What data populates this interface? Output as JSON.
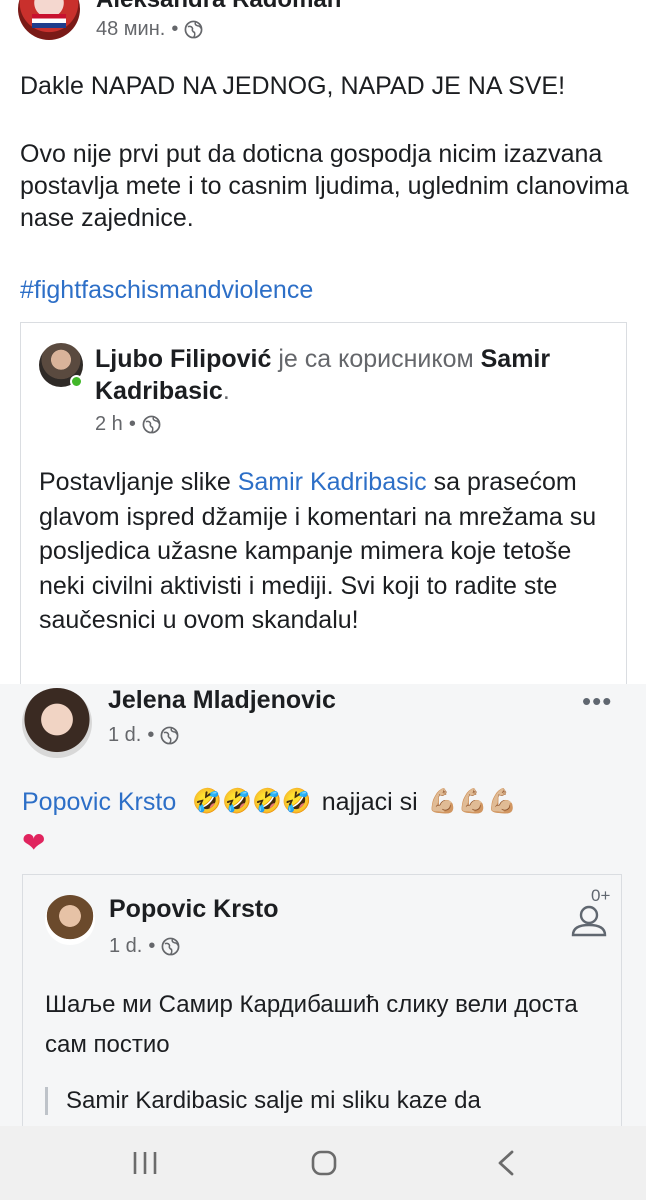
{
  "post1": {
    "author": "Aleksandra Radoman",
    "time": "48 мин.",
    "text_line1": "Dakle NAPAD NA JEDNOG, NAPAD JE NA SVE!",
    "text_para2": "Ovo nije prvi put da doticna gospodja nicim izazvana postavlja mete i to casnim ljudima, uglednim clanovima nase zajednice.",
    "hashtag": "#fightfaschismandviolence",
    "shared": {
      "author": "Ljubo Filipović",
      "with_text": "је са корисником",
      "tagged": "Samir Kadribasic",
      "tagged_suffix": ".",
      "time": "2 h",
      "text_before": "Postavljanje slike ",
      "text_link": "Samir Kadribasic",
      "text_after": " sa prasećom glavom ispred džamije i komentari na mrežama su posljedica užasne kampanje mimera koje tetoše neki civilni aktivisti i mediji. Svi koji to radite ste saučesnici u ovom skandalu!"
    }
  },
  "post2": {
    "author": "Jelena Mladjenovic",
    "time": "1 d.",
    "comment_link": "Popovic Krsto",
    "laugh_emojis": "🤣🤣🤣🤣",
    "comment_text": "najjaci si",
    "arm_emojis": "💪🏼💪🏼💪🏼",
    "heart": "❤",
    "shared": {
      "author": "Popovic Krsto",
      "time": "1 d.",
      "add_friend_label": "0+",
      "text": "Шаље ми Самир Кардибашић слику вели доста сам постио",
      "quote": "Samir Kardibasic salje mi sliku kaze da"
    }
  },
  "navbar": {
    "recent_icon": "recent-apps-icon",
    "home_icon": "home-icon",
    "back_icon": "back-icon"
  },
  "colors": {
    "link": "#2d6fc7",
    "meta": "#65676b",
    "online": "#42b72a"
  }
}
